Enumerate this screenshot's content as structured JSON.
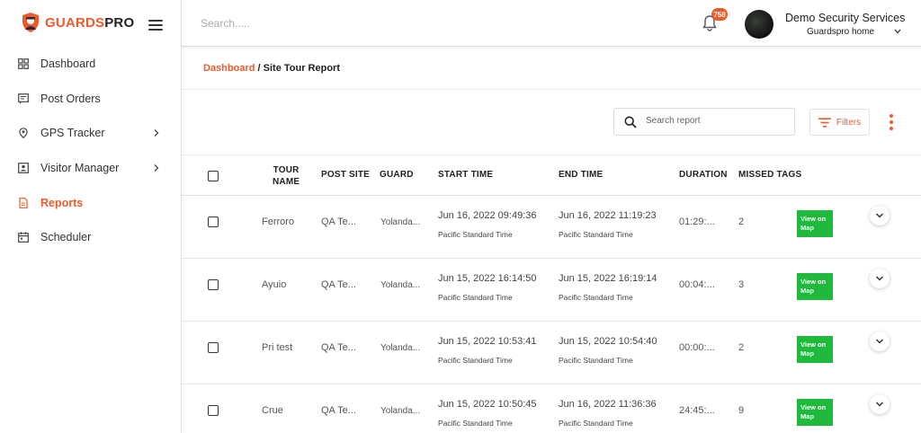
{
  "brand": {
    "part1": "GUARDS",
    "part2": "PRO",
    "color": "#ef5a2a"
  },
  "header": {
    "search_placeholder": "Search.....",
    "notification_count": "758",
    "user_name": "Demo Security Services",
    "user_sub": "Guardspro home"
  },
  "sidebar": {
    "items": [
      {
        "label": "Dashboard",
        "icon": "dashboard-icon",
        "active": false,
        "has_children": false
      },
      {
        "label": "Post Orders",
        "icon": "post-orders-icon",
        "active": false,
        "has_children": false
      },
      {
        "label": "GPS Tracker",
        "icon": "location-pin-icon",
        "active": false,
        "has_children": true
      },
      {
        "label": "Visitor Manager",
        "icon": "visitor-badge-icon",
        "active": false,
        "has_children": true
      },
      {
        "label": "Reports",
        "icon": "document-icon",
        "active": true,
        "has_children": false
      },
      {
        "label": "Scheduler",
        "icon": "calendar-icon",
        "active": false,
        "has_children": false
      }
    ]
  },
  "breadcrumb": {
    "home": "Dashboard",
    "separator": " / ",
    "current": "Site Tour Report"
  },
  "toolbar": {
    "search_placeholder": "Search report",
    "filters_label": "Filters"
  },
  "table": {
    "headers": {
      "tour_name_line1": "TOUR",
      "tour_name_line2": "NAME",
      "post_site": "POST SITE",
      "guard": "GUARD",
      "start_time": "START TIME",
      "end_time": "END TIME",
      "duration": "DURATION",
      "missed_tags": "MISSED TAGS"
    },
    "action_label": "View on Map",
    "rows": [
      {
        "tour_name": "Ferroro",
        "post_site": "QA Te...",
        "guard": "Yolanda...",
        "start": "Jun 16, 2022 09:49:36",
        "start_tz": "Pacific Standard Time",
        "end": "Jun 16, 2022 11:19:23",
        "end_tz": "Pacific Standard Time",
        "duration": "01:29:...",
        "missed": "2"
      },
      {
        "tour_name": "Ayuio",
        "post_site": "QA Te...",
        "guard": "Yolanda...",
        "start": "Jun 15, 2022 16:14:50",
        "start_tz": "Pacific Standard Time",
        "end": "Jun 15, 2022 16:19:14",
        "end_tz": "Pacific Standard Time",
        "duration": "00:04:...",
        "missed": "3"
      },
      {
        "tour_name": "Pri test",
        "post_site": "QA Te...",
        "guard": "Yolanda...",
        "start": "Jun 15, 2022 10:53:41",
        "start_tz": "Pacific Standard Time",
        "end": "Jun 15, 2022 10:54:40",
        "end_tz": "Pacific Standard Time",
        "duration": "00:00:...",
        "missed": "2"
      },
      {
        "tour_name": "Crue",
        "post_site": "QA Te...",
        "guard": "Yolanda...",
        "start": "Jun 15, 2022 10:50:45",
        "start_tz": "Pacific Standard Time",
        "end": "Jun 16, 2022 11:36:36",
        "end_tz": "Pacific Standard Time",
        "duration": "24:45:...",
        "missed": "9"
      }
    ]
  }
}
